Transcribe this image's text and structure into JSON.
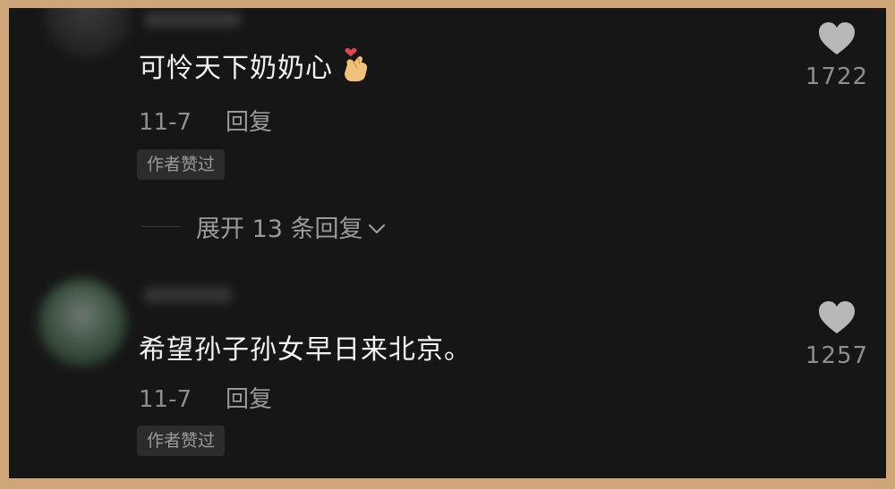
{
  "comments": [
    {
      "text": "可怜天下奶奶心",
      "emoji": "finger-heart-icon",
      "date": "11-7",
      "reply_label": "回复",
      "badge": "作者赞过",
      "likes": "1722",
      "expand_label": "展开 13 条回复"
    },
    {
      "text": "希望孙子孙女早日来北京。",
      "date": "11-7",
      "reply_label": "回复",
      "badge": "作者赞过",
      "likes": "1257"
    }
  ],
  "colors": {
    "background": "#161616",
    "frame": "#cfa67a",
    "text_primary": "#f2f2f2",
    "text_secondary": "#8e8e8e",
    "heart": "#b8b8b8"
  }
}
